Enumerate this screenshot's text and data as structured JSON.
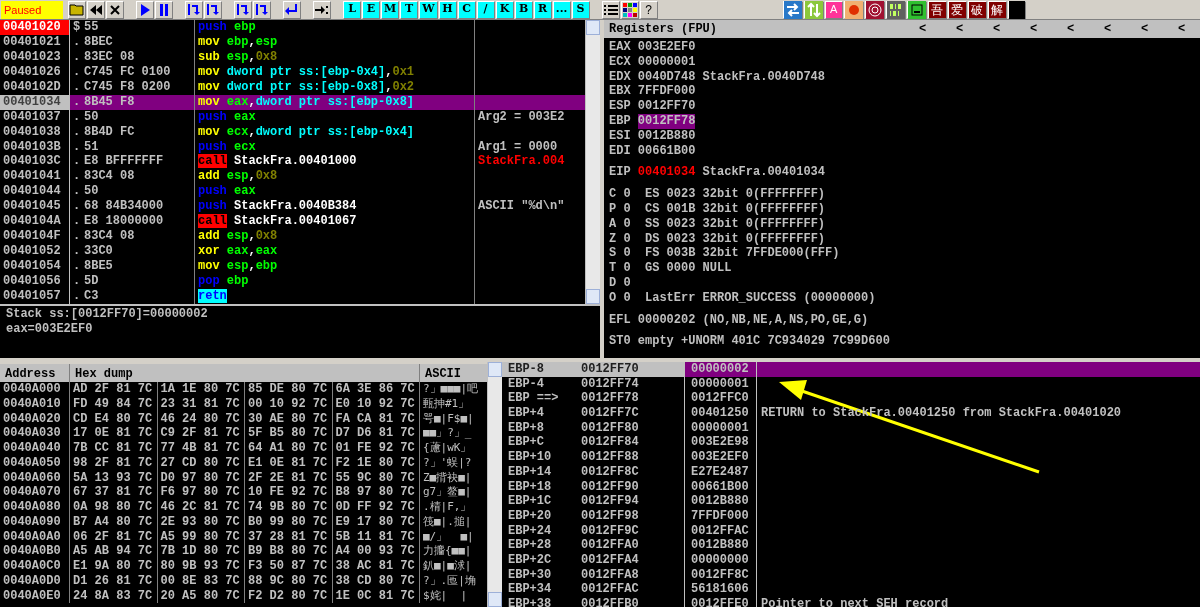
{
  "toolbar": {
    "status": "Paused",
    "letter_buttons": [
      "L",
      "E",
      "M",
      "T",
      "W",
      "H",
      "C",
      "/",
      "K",
      "B",
      "R",
      "...",
      "S"
    ],
    "help": "?",
    "plugin_letter": "A",
    "plugin_chars": [
      "吾",
      "爱",
      "破",
      "解"
    ]
  },
  "disassembly": {
    "rows": [
      {
        "address": "00401020",
        "marker": "$",
        "bytes": "55",
        "mnemonic": "push",
        "kind": "stack",
        "ops": [
          {
            "kind": "reg",
            "text": "ebp"
          }
        ],
        "breakpoint": true,
        "selected": false
      },
      {
        "address": "00401021",
        "marker": ".",
        "bytes": "8BEC",
        "mnemonic": "mov",
        "kind": "data",
        "ops": [
          {
            "kind": "reg",
            "text": "ebp"
          },
          {
            "kind": "sep",
            "text": ","
          },
          {
            "kind": "reg",
            "text": "esp"
          }
        ],
        "breakpoint": false,
        "selected": false
      },
      {
        "address": "00401023",
        "marker": ".",
        "bytes": "83EC 08",
        "mnemonic": "sub",
        "kind": "data",
        "ops": [
          {
            "kind": "reg",
            "text": "esp"
          },
          {
            "kind": "sep",
            "text": ","
          },
          {
            "kind": "imm",
            "text": "0x8"
          }
        ],
        "breakpoint": false,
        "selected": false
      },
      {
        "address": "00401026",
        "marker": ".",
        "bytes": "C745 FC 0100",
        "mnemonic": "mov",
        "kind": "data",
        "ops": [
          {
            "kind": "mem",
            "text": "dword ptr ss:[ebp-0x4]"
          },
          {
            "kind": "sep",
            "text": ","
          },
          {
            "kind": "imm",
            "text": "0x1"
          }
        ],
        "breakpoint": false,
        "selected": false
      },
      {
        "address": "0040102D",
        "marker": ".",
        "bytes": "C745 F8 0200",
        "mnemonic": "mov",
        "kind": "data",
        "ops": [
          {
            "kind": "mem",
            "text": "dword ptr ss:[ebp-0x8]"
          },
          {
            "kind": "sep",
            "text": ","
          },
          {
            "kind": "imm",
            "text": "0x2"
          }
        ],
        "breakpoint": false,
        "selected": false
      },
      {
        "address": "00401034",
        "marker": ".",
        "bytes": "8B45 F8",
        "mnemonic": "mov",
        "kind": "data",
        "ops": [
          {
            "kind": "reg",
            "text": "eax"
          },
          {
            "kind": "sep",
            "text": ","
          },
          {
            "kind": "mem",
            "text": "dword ptr ss:[ebp-0x8]"
          }
        ],
        "breakpoint": false,
        "selected": true
      },
      {
        "address": "00401037",
        "marker": ".",
        "bytes": "50",
        "mnemonic": "push",
        "kind": "stack",
        "ops": [
          {
            "kind": "reg",
            "text": "eax"
          }
        ],
        "breakpoint": false,
        "selected": false,
        "comment": {
          "kind": "arg",
          "text": "Arg2 = 003E2"
        }
      },
      {
        "address": "00401038",
        "marker": ".",
        "bytes": "8B4D FC",
        "mnemonic": "mov",
        "kind": "data",
        "ops": [
          {
            "kind": "reg",
            "text": "ecx"
          },
          {
            "kind": "sep",
            "text": ","
          },
          {
            "kind": "mem",
            "text": "dword ptr ss:[ebp-0x4]"
          }
        ],
        "breakpoint": false,
        "selected": false
      },
      {
        "address": "0040103B",
        "marker": ".",
        "bytes": "51",
        "mnemonic": "push",
        "kind": "stack",
        "ops": [
          {
            "kind": "reg",
            "text": "ecx"
          }
        ],
        "breakpoint": false,
        "selected": false,
        "comment": {
          "kind": "arg",
          "text": "Arg1 = 0000"
        }
      },
      {
        "address": "0040103C",
        "marker": ".",
        "bytes": "E8 BFFFFFFF",
        "mnemonic": "call",
        "kind": "call",
        "ops": [
          {
            "kind": "sym",
            "text": "StackFra.00401000"
          }
        ],
        "breakpoint": false,
        "selected": false,
        "comment": {
          "kind": "target",
          "text": "StackFra.004"
        }
      },
      {
        "address": "00401041",
        "marker": ".",
        "bytes": "83C4 08",
        "mnemonic": "add",
        "kind": "data",
        "ops": [
          {
            "kind": "reg",
            "text": "esp"
          },
          {
            "kind": "sep",
            "text": ","
          },
          {
            "kind": "imm",
            "text": "0x8"
          }
        ],
        "breakpoint": false,
        "selected": false
      },
      {
        "address": "00401044",
        "marker": ".",
        "bytes": "50",
        "mnemonic": "push",
        "kind": "stack",
        "ops": [
          {
            "kind": "reg",
            "text": "eax"
          }
        ],
        "breakpoint": false,
        "selected": false
      },
      {
        "address": "00401045",
        "marker": ".",
        "bytes": "68 84B34000",
        "mnemonic": "push",
        "kind": "stack",
        "ops": [
          {
            "kind": "sym",
            "text": "StackFra.0040B384"
          }
        ],
        "breakpoint": false,
        "selected": false,
        "comment": {
          "kind": "note",
          "text": "ASCII \"%d\\n\""
        }
      },
      {
        "address": "0040104A",
        "marker": ".",
        "bytes": "E8 18000000",
        "mnemonic": "call",
        "kind": "call",
        "ops": [
          {
            "kind": "sym",
            "text": "StackFra.00401067"
          }
        ],
        "breakpoint": false,
        "selected": false
      },
      {
        "address": "0040104F",
        "marker": ".",
        "bytes": "83C4 08",
        "mnemonic": "add",
        "kind": "data",
        "ops": [
          {
            "kind": "reg",
            "text": "esp"
          },
          {
            "kind": "sep",
            "text": ","
          },
          {
            "kind": "imm",
            "text": "0x8"
          }
        ],
        "breakpoint": false,
        "selected": false
      },
      {
        "address": "00401052",
        "marker": ".",
        "bytes": "33C0",
        "mnemonic": "xor",
        "kind": "data",
        "ops": [
          {
            "kind": "reg",
            "text": "eax"
          },
          {
            "kind": "sep",
            "text": ","
          },
          {
            "kind": "reg",
            "text": "eax"
          }
        ],
        "breakpoint": false,
        "selected": false
      },
      {
        "address": "00401054",
        "marker": ".",
        "bytes": "8BE5",
        "mnemonic": "mov",
        "kind": "data",
        "ops": [
          {
            "kind": "reg",
            "text": "esp"
          },
          {
            "kind": "sep",
            "text": ","
          },
          {
            "kind": "reg",
            "text": "ebp"
          }
        ],
        "breakpoint": false,
        "selected": false
      },
      {
        "address": "00401056",
        "marker": ".",
        "bytes": "5D",
        "mnemonic": "pop",
        "kind": "stack",
        "ops": [
          {
            "kind": "reg",
            "text": "ebp"
          }
        ],
        "breakpoint": false,
        "selected": false
      },
      {
        "address": "00401057",
        "marker": ".",
        "bytes": "C3",
        "mnemonic": "retn",
        "kind": "ret",
        "ops": [],
        "breakpoint": false,
        "selected": false
      }
    ],
    "info": [
      "Stack ss:[0012FF70]=00000002",
      "eax=003E2EF0"
    ]
  },
  "registers": {
    "title": "Registers (FPU)",
    "nav_arrows": [
      "<",
      "<",
      "<",
      "<",
      "<",
      "<",
      "<",
      "<"
    ],
    "general": [
      {
        "name": "EAX",
        "value": "003E2EF0",
        "selected": false,
        "changed": false
      },
      {
        "name": "ECX",
        "value": "00000001",
        "selected": false,
        "changed": false
      },
      {
        "name": "EDX",
        "value": "0040D748",
        "comment": "StackFra.0040D748",
        "selected": false,
        "changed": false
      },
      {
        "name": "EBX",
        "value": "7FFDF000",
        "selected": false,
        "changed": false
      },
      {
        "name": "ESP",
        "value": "0012FF70",
        "selected": false,
        "changed": false
      },
      {
        "name": "EBP",
        "value": "0012FF78",
        "selected": true,
        "changed": false
      },
      {
        "name": "ESI",
        "value": "0012B880",
        "selected": false,
        "changed": false
      },
      {
        "name": "EDI",
        "value": "00661B00",
        "selected": false,
        "changed": false
      }
    ],
    "eip": {
      "name": "EIP",
      "value": "00401034",
      "comment": "StackFra.00401034",
      "selected": false,
      "changed": true
    },
    "flags": [
      "C 0  ES 0023 32bit 0(FFFFFFFF)",
      "P 0  CS 001B 32bit 0(FFFFFFFF)",
      "A 0  SS 0023 32bit 0(FFFFFFFF)",
      "Z 0  DS 0023 32bit 0(FFFFFFFF)",
      "S 0  FS 003B 32bit 7FFDE000(FFF)",
      "T 0  GS 0000 NULL",
      "D 0",
      "O 0  LastErr ERROR_SUCCESS (00000000)"
    ],
    "efl": "EFL 00000202 (NO,NB,NE,A,NS,PO,GE,G)",
    "fpu": [
      "ST0 empty +UNORM 401C 7C934029 7C99D600"
    ]
  },
  "dump": {
    "columns": [
      "Address",
      "Hex dump",
      "ASCII"
    ],
    "rows": [
      {
        "address": "0040A000",
        "groups": [
          "AD 2F 81 7C",
          "1A 1E 80 7C",
          "85 DE 80 7C",
          "6A 3E 86 7C"
        ],
        "ascii": "?」■■■|吧"
      },
      {
        "address": "0040A010",
        "groups": [
          "FD 49 84 7C",
          "23 31 81 7C",
          "00 10 92 7C",
          "E0 10 92 7C"
        ],
        "ascii": "甀抻#1」"
      },
      {
        "address": "0040A020",
        "groups": [
          "CD E4 80 7C",
          "46 24 80 7C",
          "30 AE 80 7C",
          "FA CA 81 7C"
        ],
        "ascii": "咢■|F$■|"
      },
      {
        "address": "0040A030",
        "groups": [
          "17 0E 81 7C",
          "C9 2F 81 7C",
          "5F B5 80 7C",
          "D7 D6 81 7C"
        ],
        "ascii": "■■」?」_"
      },
      {
        "address": "0040A040",
        "groups": [
          "7B CC 81 7C",
          "77 4B 81 7C",
          "64 A1 80 7C",
          "01 FE 92 7C"
        ],
        "ascii": "{藘|wK」"
      },
      {
        "address": "0040A050",
        "groups": [
          "98 2F 81 7C",
          "27 CD 80 7C",
          "E1 0E 81 7C",
          "F2 1E 80 7C"
        ],
        "ascii": "?」'蜈|?"
      },
      {
        "address": "0040A060",
        "groups": [
          "5A 13 93 7C",
          "D0 97 80 7C",
          "2F 2E 81 7C",
          "55 9C 80 7C"
        ],
        "ascii": "Z■揹袂■|"
      },
      {
        "address": "0040A070",
        "groups": [
          "67 37 81 7C",
          "F6 97 80 7C",
          "10 FE 92 7C",
          "B8 97 80 7C"
        ],
        "ascii": "g7」鳌■|"
      },
      {
        "address": "0040A080",
        "groups": [
          "0A 98 80 7C",
          "46 2C 81 7C",
          "74 9B 80 7C",
          "0D FF 92 7C"
        ],
        "ascii": ".棈|F,」"
      },
      {
        "address": "0040A090",
        "groups": [
          "B7 A4 80 7C",
          "2E 93 80 7C",
          "B0 99 80 7C",
          "E9 17 80 7C"
        ],
        "ascii": "筏■|.搥|"
      },
      {
        "address": "0040A0A0",
        "groups": [
          "06 2F 81 7C",
          "A5 99 80 7C",
          "37 28 81 7C",
          "5B 11 81 7C"
        ],
        "ascii": "■/」  ■|"
      },
      {
        "address": "0040A0B0",
        "groups": [
          "A5 AB 94 7C",
          "7B 1D 80 7C",
          "B9 B8 80 7C",
          "A4 00 93 7C"
        ],
        "ascii": "力攟{■■|"
      },
      {
        "address": "0040A0C0",
        "groups": [
          "E1 9A 80 7C",
          "80 9B 93 7C",
          "F3 50 87 7C",
          "38 AC 81 7C"
        ],
        "ascii": "釟■|■浗|"
      },
      {
        "address": "0040A0D0",
        "groups": [
          "D1 26 81 7C",
          "00 8E 83 7C",
          "88 9C 80 7C",
          "38 CD 80 7C"
        ],
        "ascii": "?」.匜|埆"
      },
      {
        "address": "0040A0E0",
        "groups": [
          "24 8A 83 7C",
          "20 A5 80 7C",
          "F2 D2 80 7C",
          "1E 0C 81 7C"
        ],
        "ascii": "$姹|  |"
      }
    ]
  },
  "stack": {
    "rows": [
      {
        "label": "EBP-8",
        "address": "0012FF70",
        "value": "00000002",
        "selected": true
      },
      {
        "label": "EBP-4",
        "address": "0012FF74",
        "value": "00000001",
        "selected": false
      },
      {
        "label": "EBP ==>",
        "address": "0012FF78",
        "value": "0012FFC0",
        "selected": false
      },
      {
        "label": "EBP+4",
        "address": "0012FF7C",
        "value": "00401250",
        "comment": "RETURN to StackFra.00401250 from StackFra.00401020",
        "selected": false
      },
      {
        "label": "EBP+8",
        "address": "0012FF80",
        "value": "00000001",
        "selected": false
      },
      {
        "label": "EBP+C",
        "address": "0012FF84",
        "value": "003E2E98",
        "selected": false
      },
      {
        "label": "EBP+10",
        "address": "0012FF88",
        "value": "003E2EF0",
        "selected": false
      },
      {
        "label": "EBP+14",
        "address": "0012FF8C",
        "value": "E27E2487",
        "selected": false
      },
      {
        "label": "EBP+18",
        "address": "0012FF90",
        "value": "00661B00",
        "selected": false
      },
      {
        "label": "EBP+1C",
        "address": "0012FF94",
        "value": "0012B880",
        "selected": false
      },
      {
        "label": "EBP+20",
        "address": "0012FF98",
        "value": "7FFDF000",
        "selected": false
      },
      {
        "label": "EBP+24",
        "address": "0012FF9C",
        "value": "0012FFAC",
        "selected": false
      },
      {
        "label": "EBP+28",
        "address": "0012FFA0",
        "value": "0012B880",
        "selected": false
      },
      {
        "label": "EBP+2C",
        "address": "0012FFA4",
        "value": "00000000",
        "selected": false
      },
      {
        "label": "EBP+30",
        "address": "0012FFA8",
        "value": "0012FF8C",
        "selected": false
      },
      {
        "label": "EBP+34",
        "address": "0012FFAC",
        "value": "56181606",
        "selected": false
      },
      {
        "label": "EBP+38",
        "address": "0012FFB0",
        "value": "0012FFE0",
        "comment": "Pointer to next SEH record",
        "selected": false
      }
    ]
  }
}
